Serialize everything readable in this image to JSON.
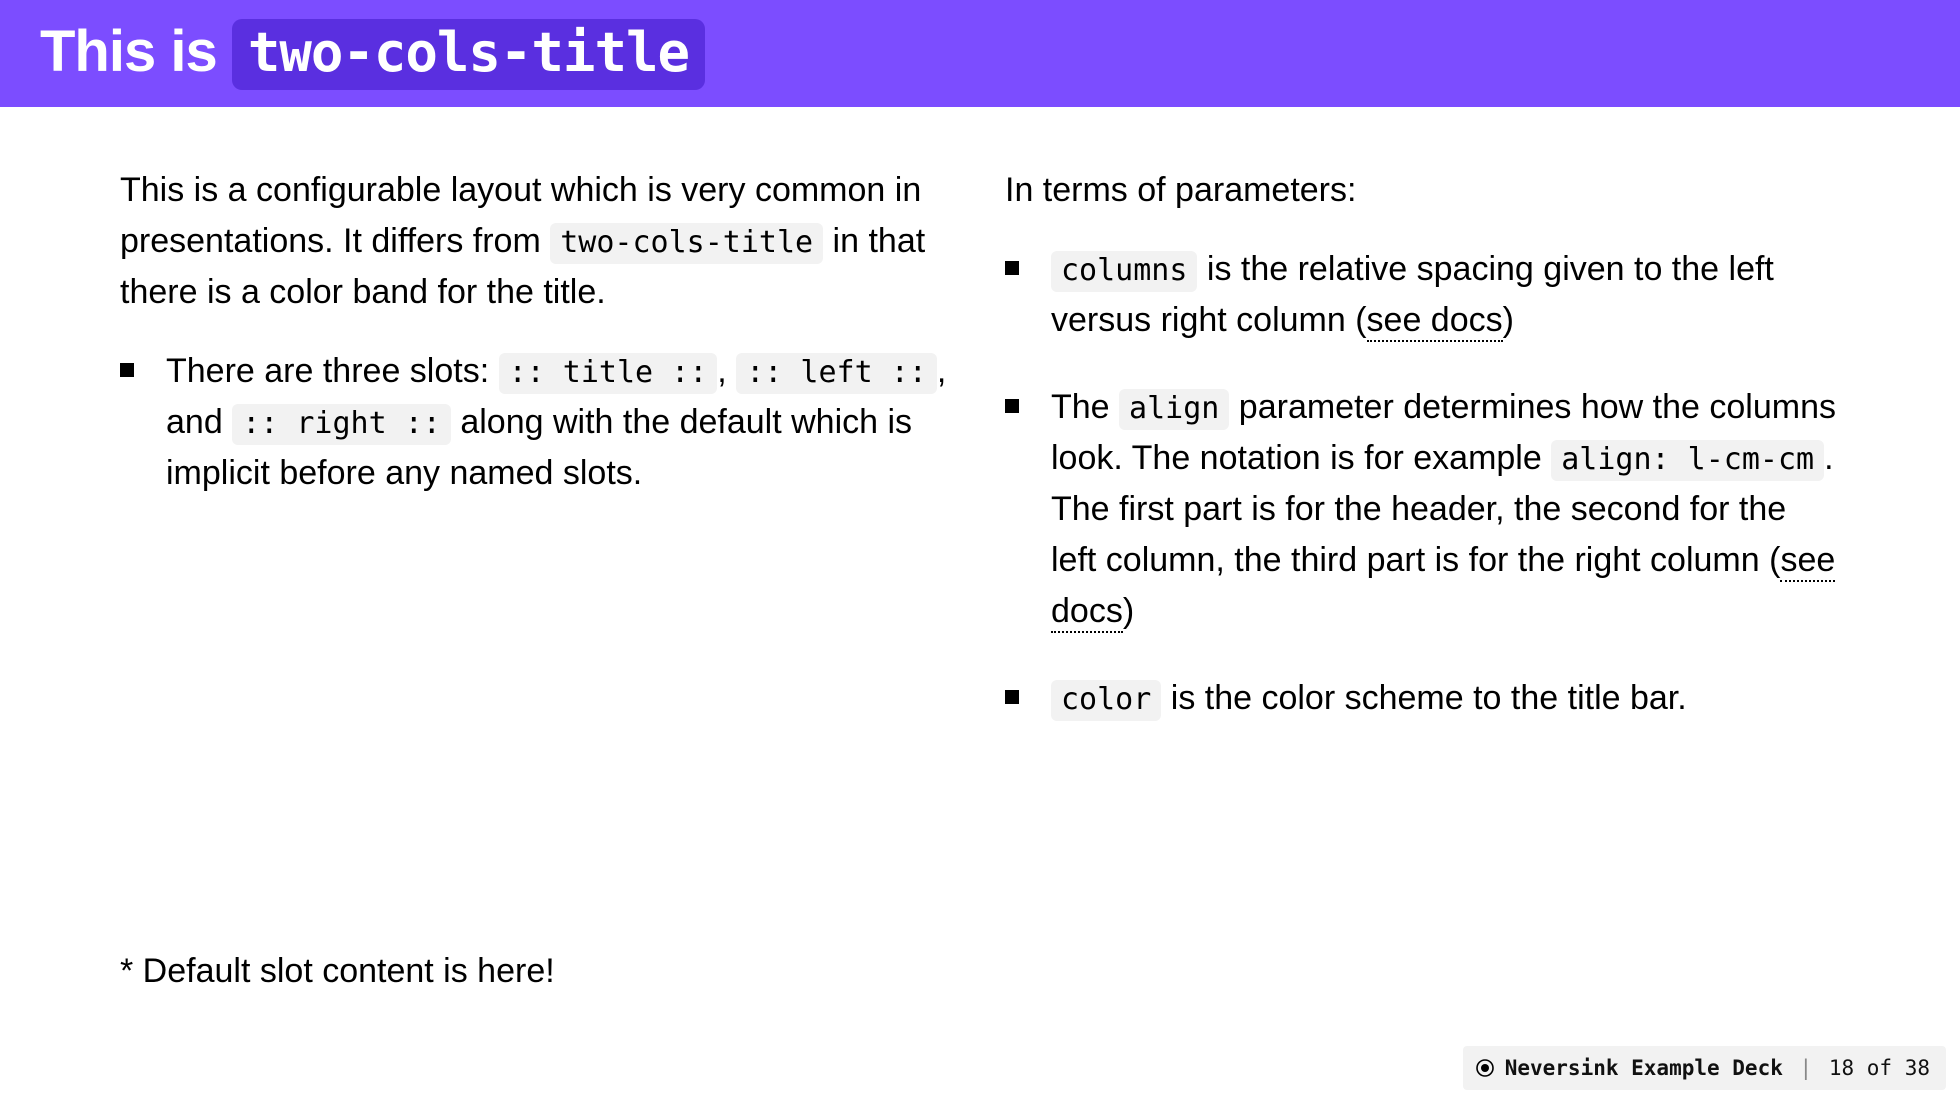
{
  "title": {
    "prefix": "This is ",
    "code": "two-cols-title"
  },
  "left": {
    "p1_a": "This is a configurable layout which is very common in presentations. It differs from ",
    "p1_code": "two-cols-title",
    "p1_b": " in that there is a color band for the title.",
    "b1_a": "There are three slots: ",
    "b1_c1": ":: title ::",
    "b1_b": ", ",
    "b1_c2": ":: left ::",
    "b1_c": ", and ",
    "b1_c3": ":: right ::",
    "b1_d": " along with the default which is implicit before any named slots."
  },
  "right": {
    "intro": "In terms of parameters:",
    "b1_code": "columns",
    "b1_a": " is the relative spacing given to the left versus right column (",
    "b1_link": "see docs",
    "b1_b": ")",
    "b2_a": "The ",
    "b2_code1": "align",
    "b2_b": " parameter determines how the columns look. The notation is for example ",
    "b2_code2": "align: l-cm-cm",
    "b2_c": ". The first part is for the header, the second for the left column, the third part is for the right column (",
    "b2_link": "see docs",
    "b2_d": ")",
    "b3_code": "color",
    "b3_a": " is the color scheme to the title bar."
  },
  "footnote": "* Default slot content is here!",
  "pager": {
    "deck": "Neversink Example Deck",
    "sep": "|",
    "pos": "18 of 38"
  }
}
